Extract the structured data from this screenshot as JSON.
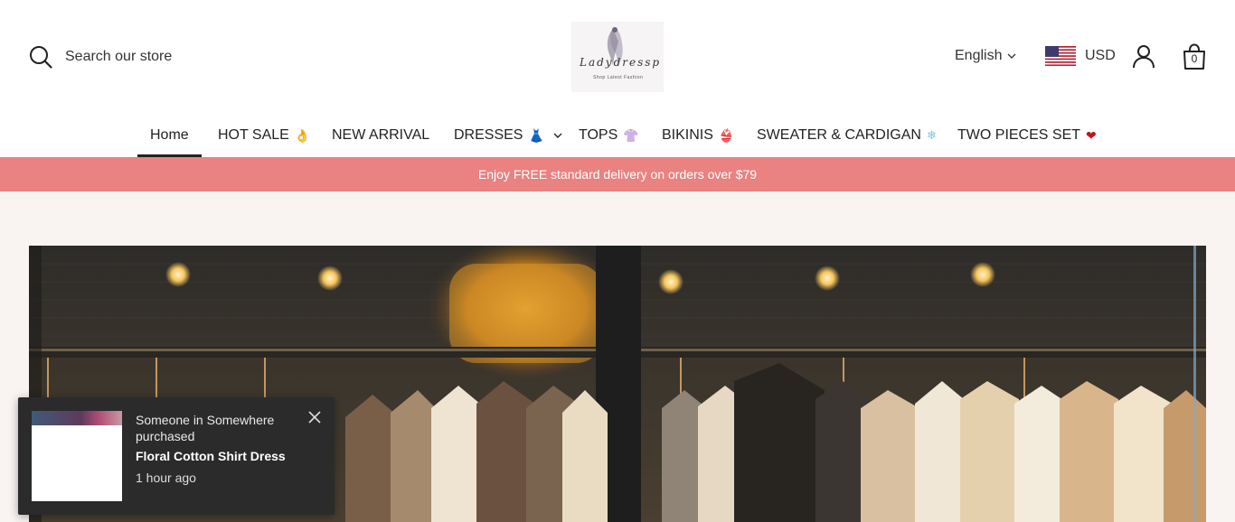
{
  "header": {
    "search_placeholder": "Search our store",
    "logo_script": "Ladydressp",
    "logo_tagline": "Shop Latest Fashion",
    "language": "English",
    "currency": "USD",
    "cart_count": "0",
    "icons": {
      "search": "search-icon",
      "chevron": "chevron-down-icon",
      "flag": "us-flag-icon",
      "account": "user-icon",
      "cart": "shopping-bag-icon"
    }
  },
  "nav": {
    "items": [
      {
        "label": "Home",
        "emoji": "",
        "active": true
      },
      {
        "label": "HOT SALE",
        "emoji": "👌"
      },
      {
        "label": "NEW ARRIVAL",
        "emoji": ""
      },
      {
        "label": "DRESSES",
        "emoji": "👗"
      },
      {
        "label": "TOPS",
        "emoji": "👚"
      },
      {
        "label": "BIKINIS",
        "emoji": "👙"
      },
      {
        "label": "SWEATER & CARDIGAN",
        "emoji": "❄"
      },
      {
        "label": "TWO PIECES SET",
        "emoji": "❤"
      }
    ]
  },
  "banner": {
    "text": "Enjoy FREE standard delivery on orders over $79",
    "color": "#e98280"
  },
  "popup": {
    "who": "Someone in Somewhere purchased",
    "product": "Floral Cotton Shirt Dress",
    "time": "1 hour ago"
  },
  "colors": {
    "accent": "#e98280",
    "page_bg": "#f9f3f2",
    "popup_bg": "#2b2b2b"
  }
}
